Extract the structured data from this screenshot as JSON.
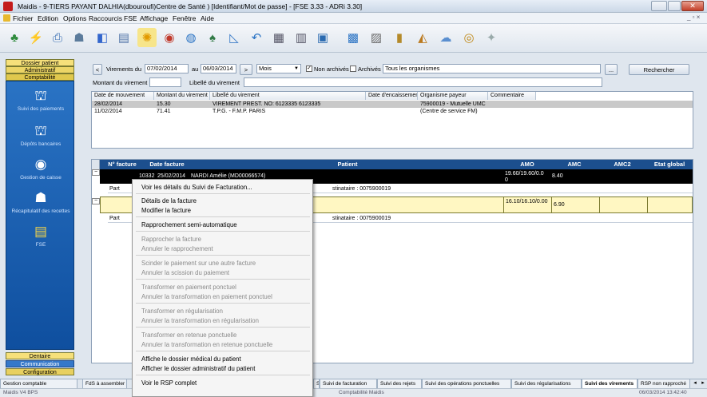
{
  "window": {
    "title": "Maidis - 9-TIERS PAYANT DALHIA(dbouroufi)Centre de Santé ) [Identifiant/Mot de passe] - [FSE 3.33 - ADRi 3.30]"
  },
  "menu": [
    "Fichier",
    "Edition",
    "Options",
    "Raccourcis",
    "FSE",
    "Affichage",
    "Fenêtre",
    "Aide"
  ],
  "toolbar_icons": [
    "patients-icon",
    "lightning-icon",
    "printer-icon",
    "users-icon",
    "folder-icon",
    "card-icon",
    "sun-icon",
    "globe-icon",
    "atlas-icon",
    "group-icon",
    "chart-icon",
    "back-icon",
    "doc-icon",
    "doc2-icon",
    "book-icon",
    "list-icon",
    "calc-icon",
    "bars-icon",
    "stack-icon",
    "cloud-icon",
    "coins-icon",
    "refresh-icon"
  ],
  "sidebar": {
    "tabs": {
      "patient": "Dossier patient",
      "admin": "Administratif",
      "compta": "Comptabilité"
    },
    "items": [
      {
        "label": "Suivi des paiements",
        "icon": "bank-icon"
      },
      {
        "label": "Dépôts bancaires",
        "icon": "bank-deposit-icon"
      },
      {
        "label": "Gestion de caisse",
        "icon": "globe-icon"
      },
      {
        "label": "Récapitulatif des recettes",
        "icon": "tax-icon"
      },
      {
        "label": "FSE",
        "icon": "fse-icon"
      }
    ],
    "bottom_tabs": {
      "dentaire": "Dentaire",
      "communication": "Communication",
      "configuration": "Configuration"
    }
  },
  "filters": {
    "virements_du_label": "Virements du",
    "date_from": "07/02/2014",
    "au_label": "au",
    "date_to": "06/03/2014",
    "period": "Mois",
    "non_archives_label": "Non archivés",
    "archives_label": "Archivés",
    "organismes": "Tous les organismes",
    "more": "...",
    "search_button": "Rechercher",
    "montant_label": "Montant du virement",
    "libelle_label": "Libellé du virement",
    "nav_prev": "<",
    "nav_next": ">"
  },
  "virements": {
    "columns": [
      "Date de mouvement",
      "Montant du virement",
      "Libellé du virement",
      "Date d'encaissement",
      "Organisme payeur",
      "Commentaire"
    ],
    "rows": [
      [
        "28/02/2014",
        "15.30",
        "VIREMENT PREST. NO: 6123335 6123335",
        "",
        "75900019 - Mutuelle UMC",
        ""
      ],
      [
        "11/02/2014",
        "71.41",
        "T.P.G. - F.M.P. PARIS",
        "",
        "(Centre de service FM)",
        ""
      ]
    ]
  },
  "factures": {
    "columns": [
      "N° facture",
      "Date facture",
      "Patient",
      "AMO",
      "AMC",
      "AMC2",
      "Etat global"
    ],
    "row1": {
      "num": "10332",
      "date": "25/02/2014",
      "patient": "NARDI Amélie (MD00066574)",
      "amo": "19.60/19.60/0.00",
      "amc": "8.40",
      "part_label": "Part",
      "destinataire": "stinataire : 0075900019"
    },
    "row2": {
      "amo": "16.10/16.10/0.00",
      "amc": "6.90",
      "part_label": "Part",
      "destinataire": "stinataire : 0075900019"
    }
  },
  "context_menu": [
    {
      "label": "Voir les détails du Suivi de Facturation...",
      "enabled": true
    },
    {
      "label": "Détails de la facture",
      "enabled": true
    },
    {
      "label": "Modifier la facture",
      "enabled": true
    },
    {
      "label": "Rapprochement semi-automatique",
      "enabled": true
    },
    {
      "label": "Rapprocher la facture",
      "enabled": false
    },
    {
      "label": "Annuler le rapprochement",
      "enabled": false
    },
    {
      "label": "Scinder le paiement sur une autre facture",
      "enabled": false
    },
    {
      "label": "Annuler la scission du paiement",
      "enabled": false
    },
    {
      "label": "Transformer en paiement ponctuel",
      "enabled": false
    },
    {
      "label": "Annuler la transformation en paiement ponctuel",
      "enabled": false
    },
    {
      "label": "Transformer en régularisation",
      "enabled": false
    },
    {
      "label": "Annuler la transformation en régularisation",
      "enabled": false
    },
    {
      "label": "Transformer en retenue ponctuelle",
      "enabled": false
    },
    {
      "label": "Annuler la transformation en retenue ponctuelle",
      "enabled": false
    },
    {
      "label": "Affiche le dossier médical du patient",
      "enabled": true
    },
    {
      "label": "Afficher le dossier administratif du patient",
      "enabled": true
    },
    {
      "label": "Voir le RSP complet",
      "enabled": true
    }
  ],
  "bottom_tabs": [
    "FdS à assembler",
    "S",
    "Suivi de facturation",
    "Suivi des rejets",
    "Suivi des opérations ponctuelles",
    "Suivi des régularisations",
    "Suivi des virements",
    "RSP non rapproché"
  ],
  "left_bottom": "Gestion comptable",
  "status": {
    "left": "Maidis V4 BPS",
    "mid": "Comptabilité Maidis",
    "date": "06/03/2014 13:42:40"
  },
  "colors": {
    "accent": "#1c4f8e",
    "selected_row": "#000000",
    "highlight_row": "#fff9c4",
    "sidebar_panel": "#1a5fb0"
  }
}
